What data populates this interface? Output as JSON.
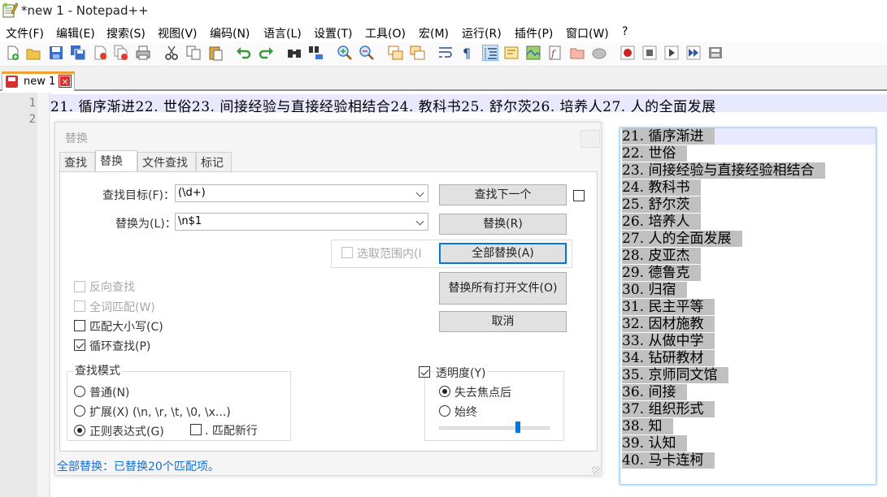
{
  "window": {
    "title": "*new 1 - Notepad++"
  },
  "menu": [
    "文件(F)",
    "编辑(E)",
    "搜索(S)",
    "视图(V)",
    "编码(N)",
    "语言(L)",
    "设置(T)",
    "工具(O)",
    "宏(M)",
    "运行(R)",
    "插件(P)",
    "窗口(W)",
    "?"
  ],
  "toolbar_icons": [
    "new-file-icon",
    "open-file-icon",
    "save-icon",
    "save-all-icon",
    "close-icon",
    "close-all-icon",
    "print-icon",
    "cut-icon",
    "copy-icon",
    "paste-icon",
    "undo-icon",
    "redo-icon",
    "find-icon",
    "replace-icon",
    "zoom-in-icon",
    "zoom-out-icon",
    "sync-vertical-icon",
    "sync-horizontal-icon",
    "word-wrap-icon",
    "show-all-chars-icon",
    "indent-guide-icon",
    "udl-icon",
    "doc-map-icon",
    "function-list-icon",
    "folder-workspace-icon",
    "monitor-icon",
    "record-macro-icon",
    "stop-record-icon",
    "play-macro-icon",
    "run-macro-multiple-icon",
    "save-macro-icon"
  ],
  "tab": {
    "label": "new 1",
    "close": "×"
  },
  "editor": {
    "line_numbers": [
      "1",
      "2"
    ],
    "line1": "21. 循序渐进22. 世俗23. 间接经验与直接经验相结合24. 教科书25. 舒尔茨26. 培养人27. 人的全面发展"
  },
  "dialog": {
    "title": "替换",
    "tabs": [
      "查找",
      "替换",
      "文件查找",
      "标记"
    ],
    "find_label": "查找目标(F)：",
    "find_value": "(\\d+)",
    "replace_label": "替换为(L)：",
    "replace_value": "\\n$1",
    "in_selection": "选取范围内(I",
    "buttons": {
      "find_next": "查找下一个",
      "replace": "替换(R)",
      "replace_all": "全部替换(A)",
      "replace_all_open": "替换所有打开文件(O)",
      "cancel": "取消"
    },
    "options": {
      "backward": "反向查找",
      "whole_word": "全词匹配(W)",
      "match_case": "匹配大小写(C)",
      "wrap_around": "循环查找(P)"
    },
    "search_mode": {
      "title": "查找模式",
      "normal": "普通(N)",
      "extended": "扩展(X) (\\n, \\r, \\t, \\0, \\x...)",
      "regex": "正则表达式(G)",
      "dot_newline": ". 匹配新行"
    },
    "transparency": {
      "title": "透明度(Y)",
      "on_lose_focus": "失去焦点后",
      "always": "始终",
      "level": 0.7
    },
    "status": "全部替换：已替换20个匹配项。"
  },
  "results": [
    "21. 循序渐进",
    "22. 世俗",
    "23. 间接经验与直接经验相结合",
    "24. 教科书",
    "25. 舒尔茨",
    "26. 培养人",
    "27. 人的全面发展",
    "28. 皮亚杰",
    "29. 德鲁克",
    "30. 归宿",
    "31. 民主平等",
    "32. 因材施教",
    "33. 从做中学",
    "34. 钻研教材",
    "35. 京师同文馆",
    "36. 间接",
    "37. 组织形式",
    "38. 知",
    "39. 认知",
    "40. 马卡连柯"
  ]
}
